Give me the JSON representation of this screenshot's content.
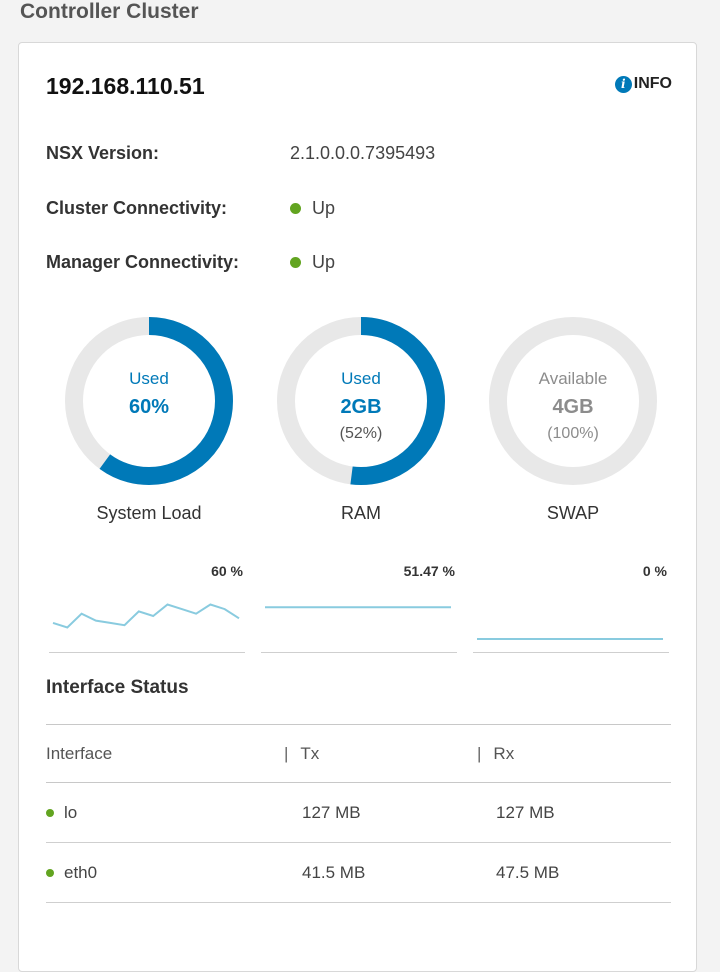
{
  "section_title": "Controller Cluster",
  "node": {
    "ip": "192.168.110.51",
    "info_label": "INFO",
    "properties": [
      {
        "label": "NSX Version:",
        "value": "2.1.0.0.0.7395493",
        "status": null
      },
      {
        "label": "Cluster Connectivity:",
        "value": "Up",
        "status": "up"
      },
      {
        "label": "Manager Connectivity:",
        "value": "Up",
        "status": "up"
      }
    ]
  },
  "gauges": [
    {
      "name": "System Load",
      "caption": "Used",
      "main": "60%",
      "pct": "",
      "fill": 0.6,
      "color": "#0079b8"
    },
    {
      "name": "RAM",
      "caption": "Used",
      "main": "2GB",
      "pct": "(52%)",
      "fill": 0.52,
      "color": "#0079b8"
    },
    {
      "name": "SWAP",
      "caption": "Available",
      "main": "4GB",
      "pct": "(100%)",
      "fill": 0.0,
      "color": "#8c8c8c"
    }
  ],
  "sparklines": [
    {
      "value_label": "60 %",
      "points": [
        52,
        50,
        56,
        53,
        52,
        51,
        57,
        55,
        60,
        58,
        56,
        60,
        58,
        54
      ]
    },
    {
      "value_label": "51.47 %",
      "points": [
        51.47,
        51.47,
        51.47,
        51.47,
        51.47,
        51.47,
        51.47,
        51.47
      ]
    },
    {
      "value_label": "0 %",
      "points": [
        0,
        0,
        0,
        0,
        0,
        0,
        0,
        0
      ]
    }
  ],
  "interface_status": {
    "title": "Interface Status",
    "columns": [
      "Interface",
      "Tx",
      "Rx"
    ],
    "separator": "|",
    "rows": [
      {
        "name": "lo",
        "tx": "127 MB",
        "rx": "127 MB"
      },
      {
        "name": "eth0",
        "tx": "41.5 MB",
        "rx": "47.5 MB"
      }
    ]
  },
  "colors": {
    "accent": "#0079b8",
    "status_up": "#62a420",
    "ring_track": "#e8e8e8",
    "spark_line": "#89cbdf"
  }
}
